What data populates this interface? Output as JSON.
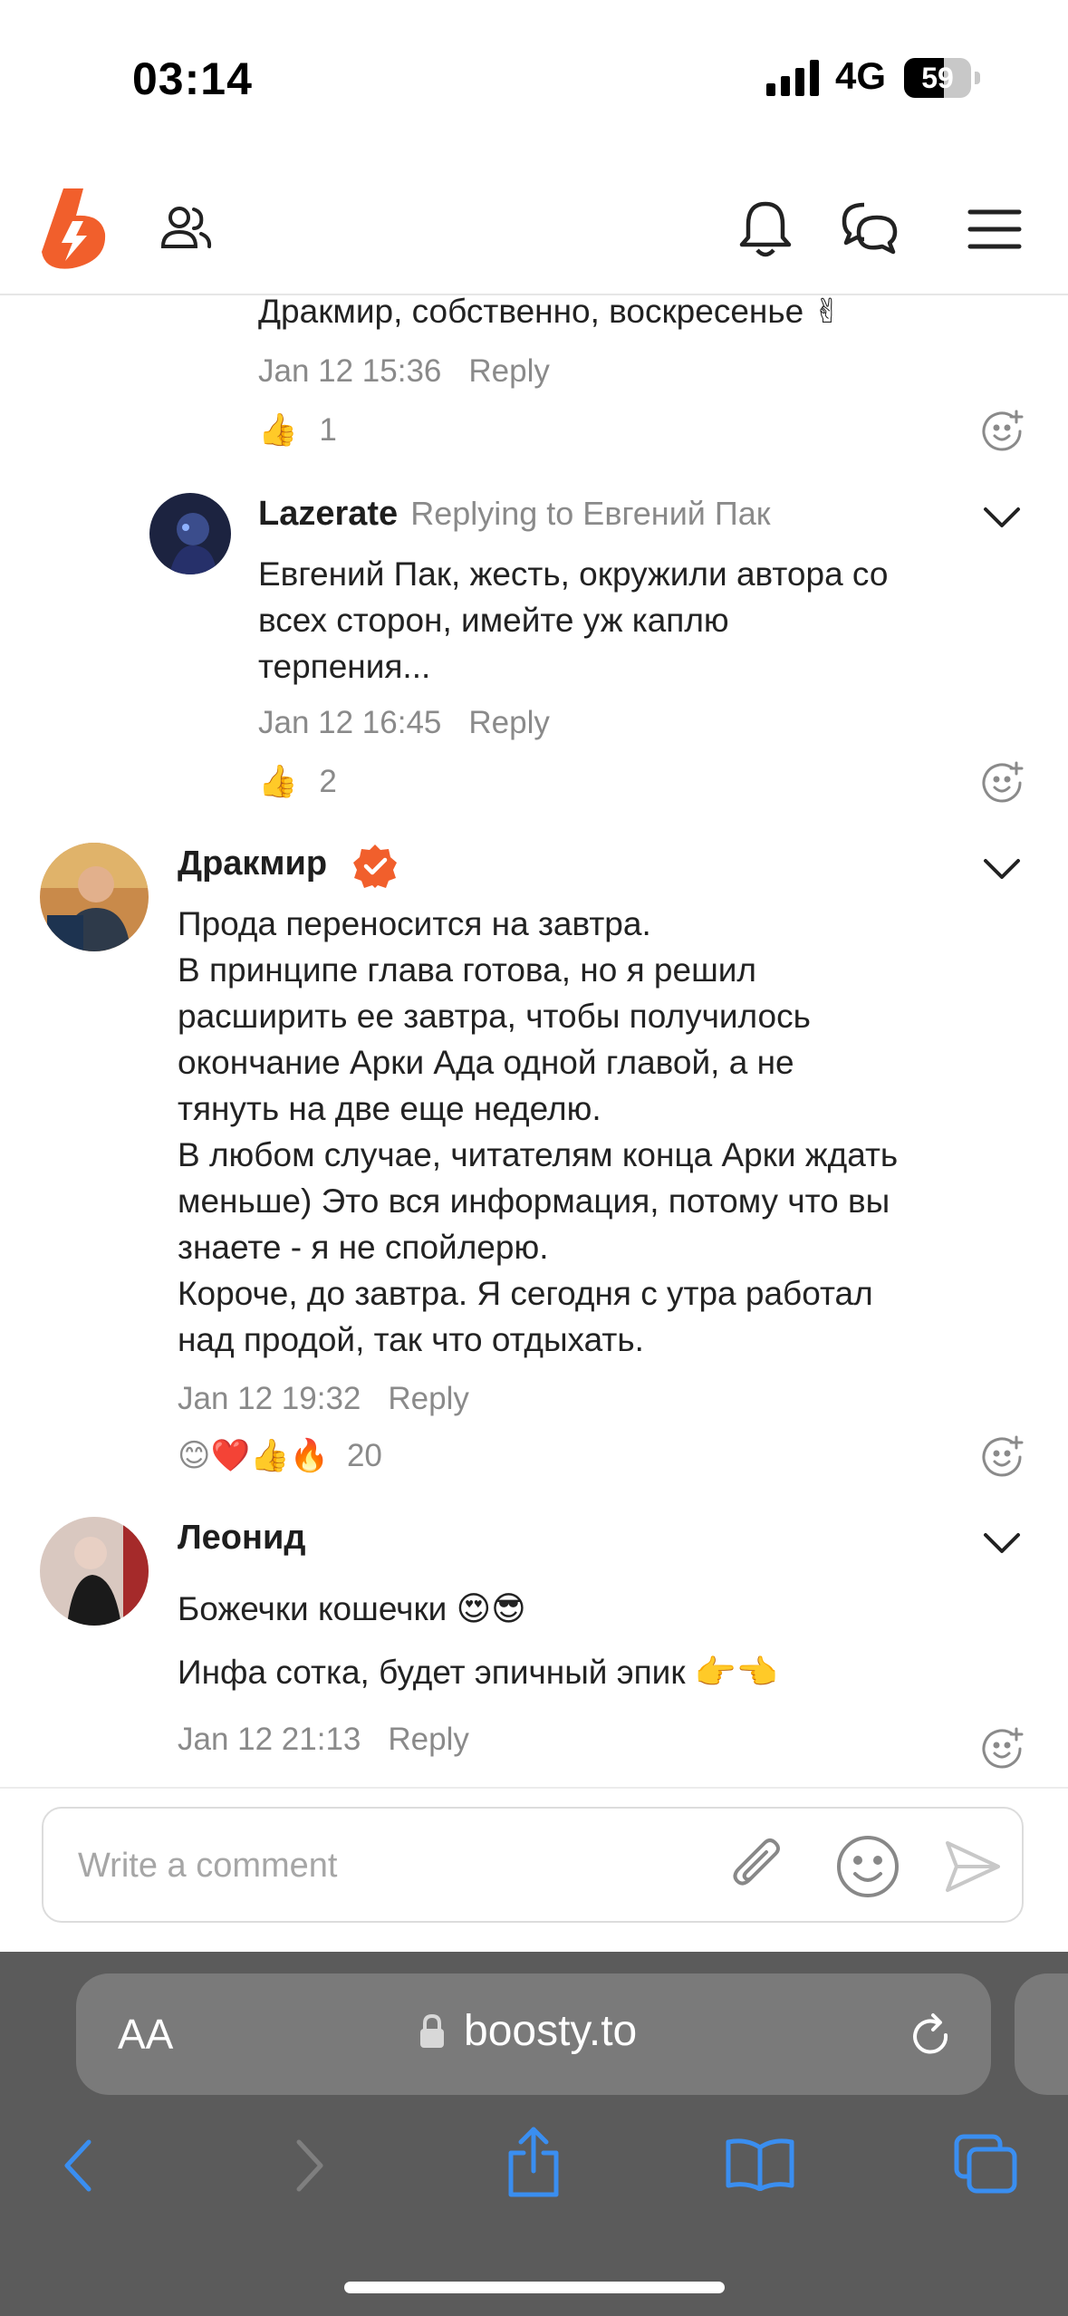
{
  "status_bar": {
    "time": "03:14",
    "network": "4G",
    "battery": "59",
    "battery_level": 0.59
  },
  "header": {
    "logo": "boosty-logo",
    "icons": [
      "community-icon",
      "bell-icon",
      "chat-icon",
      "menu-icon"
    ]
  },
  "comments": [
    {
      "text": "Дракмир, собственно, воскресенье ✌",
      "date": "Jan 12 15:36",
      "reply_label": "Reply",
      "likes": "1"
    },
    {
      "author": "Lazerate",
      "replying_to": "Replying to Евгений Пак",
      "text": "Евгений Пак, жесть, окружили автора со\nвсех сторон, имейте уж каплю\nтерпения...",
      "date": "Jan 12 16:45",
      "reply_label": "Reply",
      "likes": "2"
    },
    {
      "author": "Дракмир",
      "verified": true,
      "text": "Прода переносится на завтра.\nВ принципе глава готова, но я решил\nрасширить ее завтра, чтобы получилось\nокончание Арки Ада одной главой, а не\nтянуть на две еще неделю.\nВ любом случае, читателям конца Арки ждать\nменьше) Это вся информация, потому что вы\nзнаете - я не спойлерю.\nКороче, до завтра. Я сегодня с утра работал\nнад продой, так что отдыхать.",
      "date": "Jan 12 19:32",
      "reply_label": "Reply",
      "likes": "20"
    },
    {
      "author": "Леонид",
      "line1": "Божечки кошечки 😍😎",
      "line2": "Инфа сотка, будет эпичный эпик 👉👈",
      "date": "Jan 12 21:13",
      "reply_label": "Reply"
    }
  ],
  "composer": {
    "placeholder": "Write a comment"
  },
  "browser": {
    "aa_label": "AA",
    "url": "boosty.to"
  },
  "colors": {
    "brand": "#f15f2c",
    "ios_blue": "#3a8ef0",
    "text": "#222222",
    "muted": "#8a8a8a"
  }
}
